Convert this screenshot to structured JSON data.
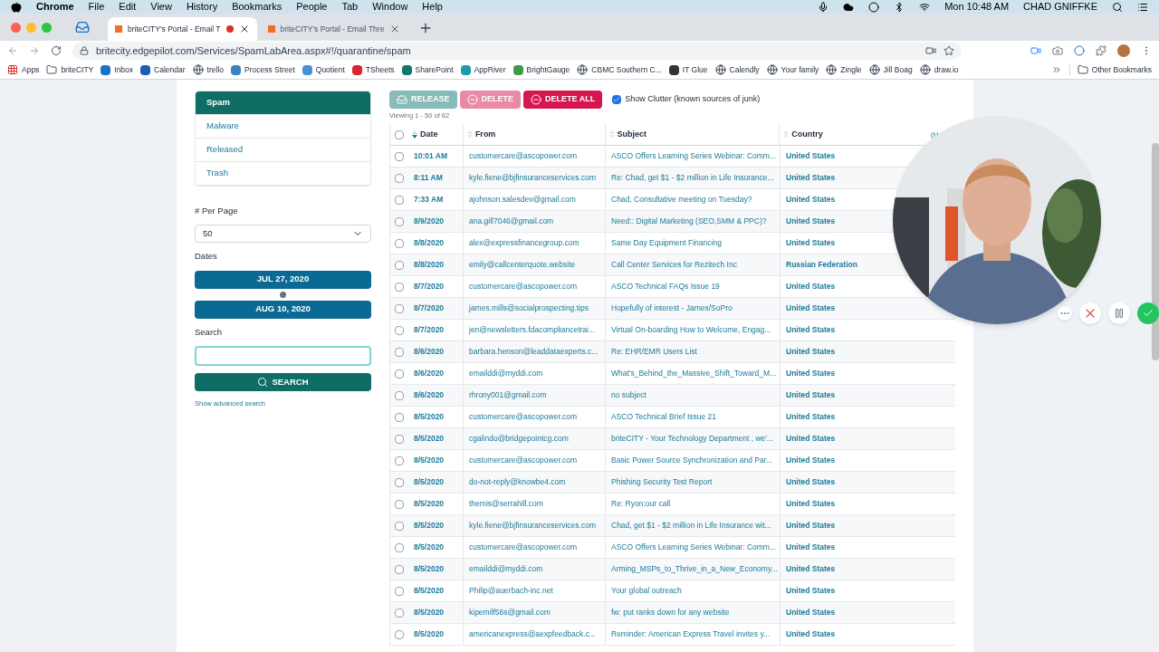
{
  "menu_bar": {
    "app": "Chrome",
    "items": [
      "File",
      "Edit",
      "View",
      "History",
      "Bookmarks",
      "People",
      "Tab",
      "Window",
      "Help"
    ],
    "clock": "Mon 10:48 AM",
    "user": "CHAD GNIFFKE"
  },
  "tabs": [
    {
      "title": "briteCITY's Portal - Email T",
      "selected": true,
      "recording": true
    },
    {
      "title": "briteCITY's Portal - Email Thre",
      "selected": false,
      "recording": false
    }
  ],
  "address": {
    "url": "britecity.edgepilot.com/Services/SpamLabArea.aspx#!/quarantine/spam"
  },
  "bookmarks": [
    {
      "label": "Apps",
      "kind": "grid"
    },
    {
      "label": "briteCITY",
      "kind": "folder"
    },
    {
      "label": "Inbox",
      "kind": "site",
      "color": "#1a73c9"
    },
    {
      "label": "Calendar",
      "kind": "site",
      "color": "#1a5fb4"
    },
    {
      "label": "trello",
      "kind": "globe"
    },
    {
      "label": "Process Street",
      "kind": "site",
      "color": "#3b82c4"
    },
    {
      "label": "Quotient",
      "kind": "site",
      "color": "#4a90d9"
    },
    {
      "label": "TSheets",
      "kind": "site",
      "color": "#d9232d"
    },
    {
      "label": "SharePoint",
      "kind": "site",
      "color": "#0e7a6e"
    },
    {
      "label": "AppRiver",
      "kind": "site",
      "color": "#1f9bb0"
    },
    {
      "label": "BrightGauge",
      "kind": "site",
      "color": "#3f9a4a"
    },
    {
      "label": "CBMC Southern C...",
      "kind": "globe"
    },
    {
      "label": "IT Glue",
      "kind": "site",
      "color": "#333333"
    },
    {
      "label": "Calendly",
      "kind": "globe"
    },
    {
      "label": "Your family",
      "kind": "globe"
    },
    {
      "label": "Zingle",
      "kind": "globe"
    },
    {
      "label": "Jill Boag",
      "kind": "globe"
    },
    {
      "label": "draw.io",
      "kind": "globe"
    }
  ],
  "other_bookmarks": "Other Bookmarks",
  "sidebar": {
    "items": [
      {
        "label": "Spam",
        "selected": true
      },
      {
        "label": "Malware",
        "selected": false
      },
      {
        "label": "Released",
        "selected": false
      },
      {
        "label": "Trash",
        "selected": false
      }
    ],
    "per_page_label": "# Per Page",
    "per_page_value": "50",
    "dates_label": "Dates",
    "date_from": "JUL 27, 2020",
    "date_to": "AUG 10, 2020",
    "search_label": "Search",
    "search_button": "SEARCH",
    "advanced_link": "Show advanced search"
  },
  "toolbar": {
    "buttons": [
      {
        "label": "RELEASE",
        "kind": "release",
        "disabled": true
      },
      {
        "label": "DELETE",
        "kind": "delete",
        "disabled": true
      },
      {
        "label": "DELETE ALL",
        "kind": "delete",
        "disabled": false
      }
    ],
    "clutter": {
      "label": "Show Clutter (known sources of junk)",
      "checked": true
    },
    "viewing": "Viewing 1 - 50 of 62"
  },
  "table": {
    "select_all_checked": false,
    "columns": [
      "Date",
      "From",
      "Subject",
      "Country",
      "(H"
    ],
    "rows": [
      {
        "checked": false,
        "cells": [
          "10:01 AM",
          "customercare@ascopower.com",
          "ASCO Offers Learning Series Webinar: Comm...",
          "United States"
        ]
      },
      {
        "checked": false,
        "cells": [
          "8:11 AM",
          "kyle.fiene@bjfinsuranceservices.com",
          "Re: Chad, get $1 - $2 million in Life Insurance...",
          "United States"
        ]
      },
      {
        "checked": false,
        "cells": [
          "7:33 AM",
          "ajohnson.salesdev@gmail.com",
          "Chad, Consultative meeting on Tuesday?",
          "United States"
        ]
      },
      {
        "checked": false,
        "cells": [
          "8/9/2020",
          "ana.gill7046@gmail.com",
          "Need:: Digital Marketing (SEO,SMM & PPC)?",
          "United States"
        ]
      },
      {
        "checked": false,
        "cells": [
          "8/8/2020",
          "alex@expressfinancegroup.com",
          "Same Day Equipment Financing",
          "United States"
        ]
      },
      {
        "checked": false,
        "cells": [
          "8/8/2020",
          "emily@callcenterquote.website",
          "Call Center Services for Rezitech Inc",
          "Russian Federation"
        ]
      },
      {
        "checked": false,
        "cells": [
          "8/7/2020",
          "customercare@ascopower.com",
          "ASCO Technical FAQs Issue 19",
          "United States"
        ]
      },
      {
        "checked": false,
        "cells": [
          "8/7/2020",
          "james.mills@socialprospecting.tips",
          "Hopefully of interest - James/SoPro",
          "United States"
        ]
      },
      {
        "checked": false,
        "cells": [
          "8/7/2020",
          "jen@newsletters.fdacompliancetrai...",
          "Virtual On-boarding How to Welcome, Engag...",
          "United States"
        ]
      },
      {
        "checked": false,
        "cells": [
          "8/6/2020",
          "barbara.henson@leaddataexperts.c...",
          "Re: EHR/EMR Users List",
          "United States"
        ]
      },
      {
        "checked": false,
        "cells": [
          "8/6/2020",
          "emailddi@myddi.com",
          "What's_Behind_the_Massive_Shift_Toward_M...",
          "United States"
        ]
      },
      {
        "checked": false,
        "cells": [
          "8/6/2020",
          "rhrony001@gmail.com",
          "no subject",
          "United States"
        ]
      },
      {
        "checked": false,
        "cells": [
          "8/5/2020",
          "customercare@ascopower.com",
          "ASCO Technical Brief Issue 21",
          "United States"
        ]
      },
      {
        "checked": false,
        "cells": [
          "8/5/2020",
          "cgalindo@bridgepointcg.com",
          "briteCITY - Your Technology Department , we'...",
          "United States"
        ]
      },
      {
        "checked": false,
        "cells": [
          "8/5/2020",
          "customercare@ascopower.com",
          "Basic Power Source Synchronization and Par...",
          "United States"
        ]
      },
      {
        "checked": false,
        "cells": [
          "8/5/2020",
          "do-not-reply@knowbe4.com",
          "Phishing Security Test Report",
          "United States"
        ]
      },
      {
        "checked": false,
        "cells": [
          "8/5/2020",
          "themis@serrahill.com",
          "Re: Ryon:our call",
          "United States"
        ]
      },
      {
        "checked": false,
        "cells": [
          "8/5/2020",
          "kyle.fiene@bjfinsuranceservices.com",
          "Chad, get $1 - $2 million in Life Insurance wit...",
          "United States"
        ]
      },
      {
        "checked": false,
        "cells": [
          "8/5/2020",
          "customercare@ascopower.com",
          "ASCO Offers Learning Series Webinar: Comm...",
          "United States"
        ]
      },
      {
        "checked": false,
        "cells": [
          "8/5/2020",
          "emailddi@myddi.com",
          "Arming_MSPs_to_Thrive_in_a_New_Economy...",
          "United States"
        ]
      },
      {
        "checked": false,
        "cells": [
          "8/5/2020",
          "Philip@auerbach-inc.net",
          "Your global outreach",
          "United States"
        ]
      },
      {
        "checked": false,
        "cells": [
          "8/5/2020",
          "kipemilf56s@gmail.com",
          "fw: put ranks down for any website",
          "United States"
        ]
      },
      {
        "checked": false,
        "cells": [
          "8/5/2020",
          "americanexpress@aexpfeedback.c...",
          "Reminder: American Express Travel invites y...",
          "United States"
        ]
      }
    ]
  }
}
